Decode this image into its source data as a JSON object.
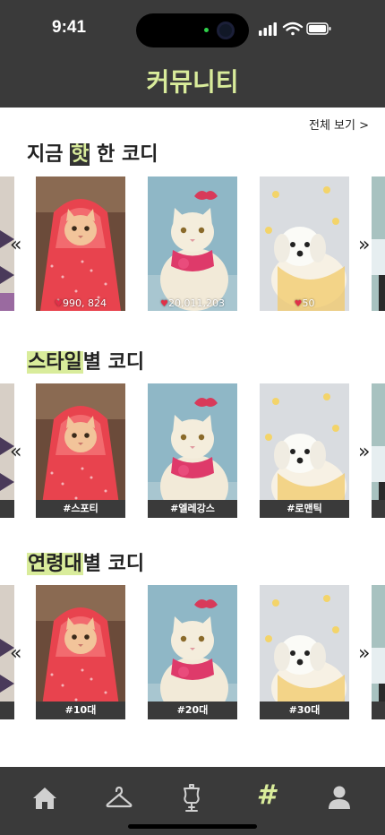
{
  "status_bar": {
    "time": "9:41"
  },
  "header": {
    "title": "커뮤니티"
  },
  "hot": {
    "see_all": "전체 보기 >",
    "title_pre": "지금 ",
    "title_hl": "핫",
    "title_post": " 한 코디",
    "likes": [
      "990, 824",
      "20,011,203",
      "50"
    ]
  },
  "style": {
    "title_hl": "스타일",
    "title_post": "별 코디",
    "tags": [
      "#스포티",
      "#엘레강스",
      "#로맨틱"
    ]
  },
  "age": {
    "title_hl": "연령대",
    "title_post": "별 코디",
    "tags": [
      "#10대",
      "#20대",
      "#30대"
    ]
  },
  "nav": {
    "prev_arrow": "«",
    "next_arrow": "»",
    "items": [
      "home-icon",
      "hanger-icon",
      "mannequin-icon",
      "hashtag-icon",
      "profile-icon"
    ],
    "active": "hashtag-icon",
    "active_color": "#d9ec9b",
    "inactive_color": "#d0d0d0"
  },
  "colors": {
    "header_bg": "#3a3a3a",
    "accent": "#d9ec9b"
  }
}
